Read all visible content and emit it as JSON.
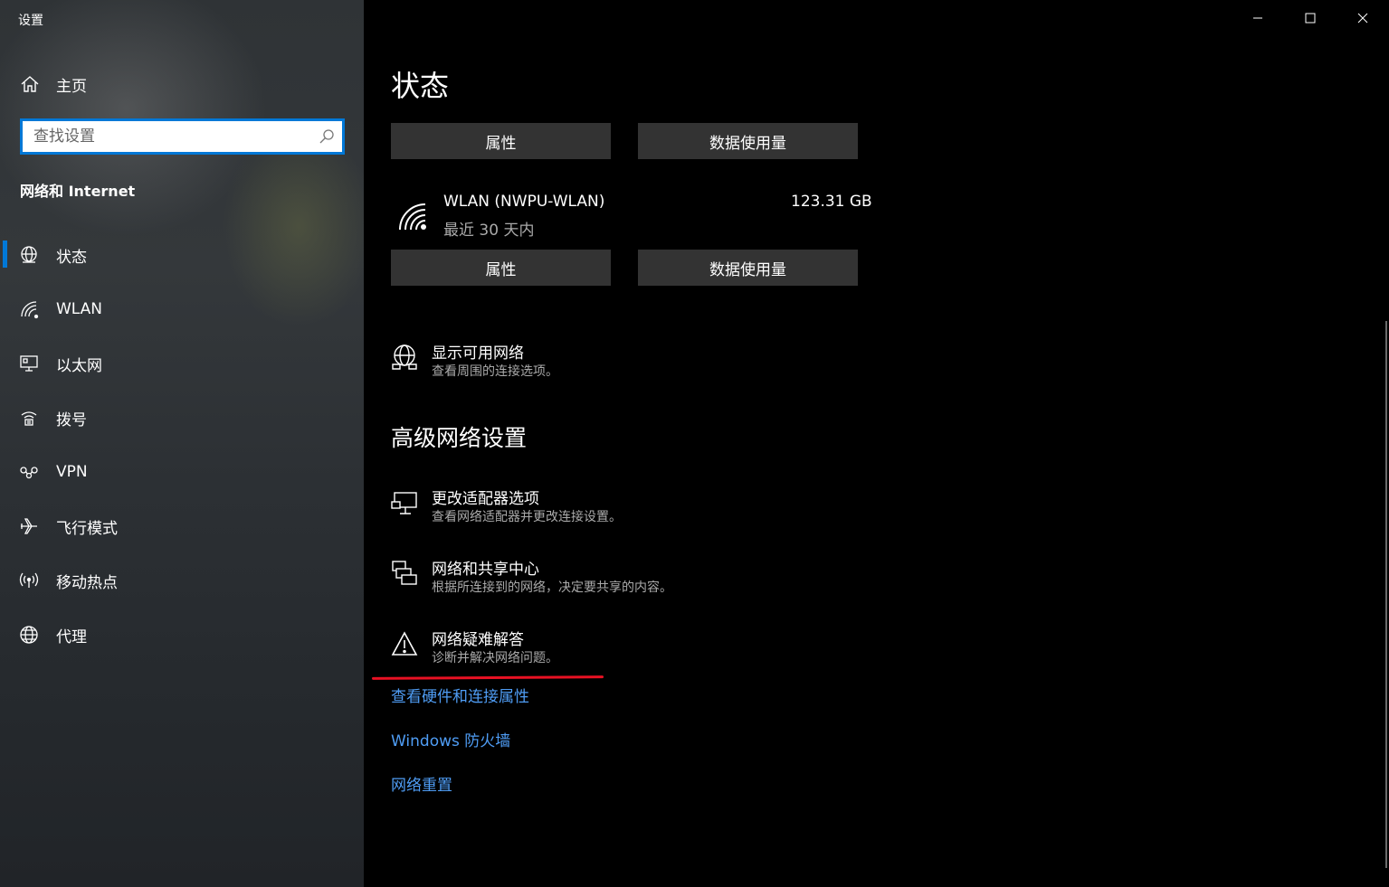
{
  "window": {
    "title": "设置"
  },
  "sidebar": {
    "home_label": "主页",
    "search_placeholder": "查找设置",
    "section_title": "网络和 Internet",
    "items": [
      {
        "label": "状态",
        "icon": "globe-status-icon",
        "selected": true
      },
      {
        "label": "WLAN",
        "icon": "wifi-icon"
      },
      {
        "label": "以太网",
        "icon": "ethernet-icon"
      },
      {
        "label": "拨号",
        "icon": "dialup-icon"
      },
      {
        "label": "VPN",
        "icon": "vpn-icon"
      },
      {
        "label": "飞行模式",
        "icon": "airplane-icon"
      },
      {
        "label": "移动热点",
        "icon": "hotspot-icon"
      },
      {
        "label": "代理",
        "icon": "globe-icon"
      }
    ]
  },
  "main": {
    "title": "状态",
    "top_buttons": {
      "properties": "属性",
      "data_usage": "数据使用量"
    },
    "connection": {
      "name": "WLAN (NWPU-WLAN)",
      "period": "最近 30 天内",
      "usage": "123.31 GB",
      "properties": "属性",
      "data_usage": "数据使用量"
    },
    "show_networks": {
      "title": "显示可用网络",
      "desc": "查看周围的连接选项。"
    },
    "advanced_heading": "高级网络设置",
    "advanced": [
      {
        "title": "更改适配器选项",
        "desc": "查看网络适配器并更改连接设置。",
        "icon": "adapter-icon"
      },
      {
        "title": "网络和共享中心",
        "desc": "根据所连接到的网络，决定要共享的内容。",
        "icon": "sharing-center-icon"
      },
      {
        "title": "网络疑难解答",
        "desc": "诊断并解决网络问题。",
        "icon": "warning-icon"
      }
    ],
    "links": {
      "hardware": "查看硬件和连接属性",
      "firewall": "Windows 防火墙",
      "reset": "网络重置"
    }
  },
  "colors": {
    "accent": "#0078d7",
    "link": "#4f9df5",
    "annotation": "#e81123"
  }
}
